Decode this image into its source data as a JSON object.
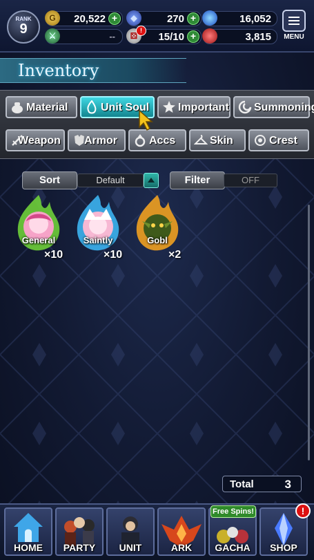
{
  "header": {
    "rank_label": "RANK",
    "rank_value": "9",
    "gil": "20,522",
    "lapis": "270",
    "blue_orb": "16,052",
    "sword_resource": "--",
    "energy": "15/10",
    "red_orb": "3,815",
    "energy_badge": "!",
    "menu_label": "MENU"
  },
  "page_title": "Inventory",
  "tabs_row1": [
    "Material",
    "Unit Soul",
    "Important",
    "Summoning"
  ],
  "tabs_row2": [
    "Weapon",
    "Armor",
    "Accs",
    "Skin",
    "Crest"
  ],
  "active_tab": "Unit Soul",
  "sort": {
    "label": "Sort",
    "value": "Default"
  },
  "filter": {
    "label": "Filter",
    "value": "OFF"
  },
  "souls": [
    {
      "name": "General",
      "count": "×10",
      "flame": "#8ee04a"
    },
    {
      "name": "Saintly",
      "count": "×10",
      "flame": "#56c8ff"
    },
    {
      "name": "Gobl",
      "count": "×2",
      "flame": "#f2a623"
    }
  ],
  "total": {
    "label": "Total",
    "value": "3"
  },
  "nav": {
    "home": "HOME",
    "party": "PARTY",
    "unit": "UNIT",
    "ark": "ARK",
    "gacha": "GACHA",
    "shop": "SHOP",
    "free_spins": "Free Spins!",
    "shop_alert": "!"
  },
  "colors": {
    "active_tab": "#2bc2cd",
    "background": "#121a33"
  }
}
